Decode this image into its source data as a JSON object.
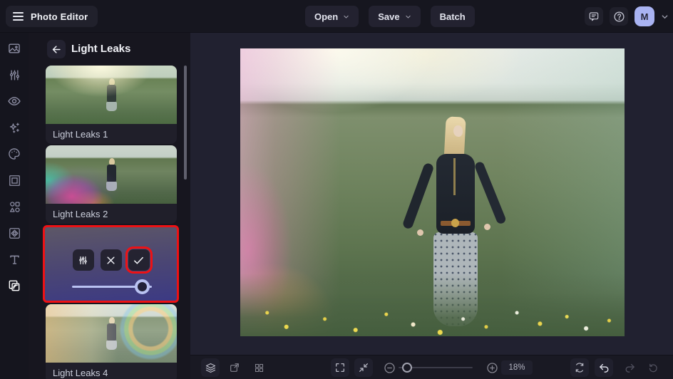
{
  "app": {
    "title": "Photo Editor"
  },
  "topbar": {
    "open": "Open",
    "save": "Save",
    "batch": "Batch",
    "avatar_initial": "M"
  },
  "sidebar": {
    "tools": [
      {
        "name": "photo",
        "icon": "photo-icon"
      },
      {
        "name": "adjust",
        "icon": "sliders-icon"
      },
      {
        "name": "touch-up",
        "icon": "eye-icon"
      },
      {
        "name": "effects",
        "icon": "sparkles-icon"
      },
      {
        "name": "artsy",
        "icon": "palette-icon"
      },
      {
        "name": "frames",
        "icon": "frame-icon"
      },
      {
        "name": "graphics",
        "icon": "shapes-icon"
      },
      {
        "name": "overlays",
        "icon": "ornate-frame-icon"
      },
      {
        "name": "text",
        "icon": "text-icon"
      },
      {
        "name": "textures",
        "icon": "overlap-squares-icon",
        "active": true
      }
    ]
  },
  "panel": {
    "title": "Light Leaks",
    "items": [
      {
        "label": "Light Leaks 1"
      },
      {
        "label": "Light Leaks 2"
      },
      {
        "selected": true,
        "intensity_percent": 88
      },
      {
        "label": "Light Leaks 4"
      }
    ]
  },
  "bottombar": {
    "zoom_display": "18%",
    "zoom_slider_percent": 12
  },
  "annotations": {
    "highlight_color": "#ee1114",
    "highlighted": [
      "selected-effect-card",
      "apply-effect-button"
    ]
  },
  "colors": {
    "avatar_bg": "#a9b3f2",
    "slider_accent": "#b9c2f2",
    "selected_card_gradient_top": "#5d5767",
    "selected_card_gradient_bottom": "#3c3a84",
    "topbar_bg": "#16161f",
    "canvas_bg": "#212130"
  },
  "icons": {
    "hamburger-icon": "three bars",
    "chevron-down-icon": "v",
    "comment-icon": "speech bubble",
    "help-icon": "question mark in circle",
    "back-arrow-icon": "left arrow",
    "settings-sliders-icon": "vertical sliders",
    "cancel-x-icon": "x",
    "apply-check-icon": "checkmark",
    "layers-icon": "stacked layers",
    "resize-icon": "square with diagonal arrow",
    "grid-icon": "four squares",
    "fullscreen-icon": "corner brackets",
    "fit-screen-icon": "inward arrows",
    "zoom-out-icon": "minus in circle",
    "zoom-in-icon": "plus in circle",
    "compare-icon": "circular arrows",
    "undo-icon": "curved left arrow",
    "redo-icon": "curved right arrow",
    "history-icon": "clockwise reset"
  }
}
